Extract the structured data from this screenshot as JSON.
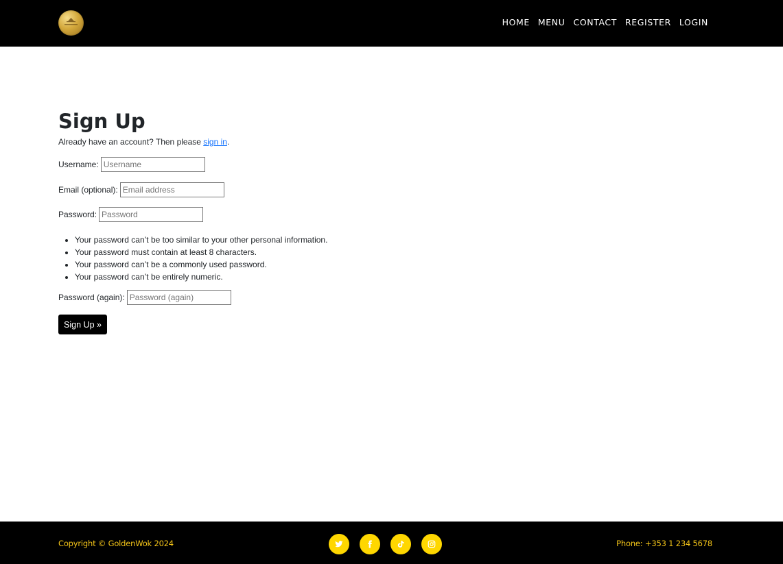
{
  "nav": {
    "logo_icon": "golden-wok-logo",
    "links": [
      "HOME",
      "MENU",
      "CONTACT",
      "REGISTER",
      "LOGIN"
    ]
  },
  "signup": {
    "title": "Sign Up",
    "intro_prefix": "Already have an account? Then please ",
    "intro_link": "sign in",
    "intro_suffix": ".",
    "username_label": "Username:",
    "username_placeholder": "Username",
    "email_label": "Email (optional):",
    "email_placeholder": "Email address",
    "password_label": "Password:",
    "password_placeholder": "Password",
    "help": [
      "Your password can’t be too similar to your other personal information.",
      "Your password must contain at least 8 characters.",
      "Your password can’t be a commonly used password.",
      "Your password can’t be entirely numeric."
    ],
    "password2_label": "Password (again):",
    "password2_placeholder": "Password (again)",
    "submit_label": "Sign Up »"
  },
  "footer": {
    "copyright": "Copyright © GoldenWok 2024",
    "phone": "Phone: +353 1 234 5678",
    "socials": [
      "twitter-icon",
      "facebook-icon",
      "tiktok-icon",
      "instagram-icon"
    ]
  },
  "colors": {
    "accent": "#ffd700",
    "footer_text": "#f5c518",
    "link": "#0d6efd",
    "bar": "#000000"
  }
}
